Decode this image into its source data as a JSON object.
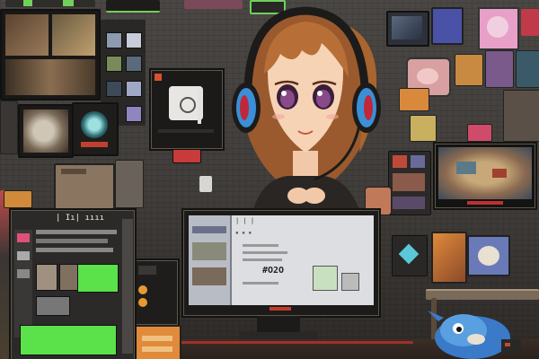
{
  "scene": {
    "description_free": true,
    "wall_color": "#45423f",
    "accent_colors": {
      "hair": "#b5703a",
      "headphone_blue": "#3a8fd8",
      "headphone_red": "#c0283a",
      "green_display": "#5be24a",
      "monitor_frame": "#1c1b1a"
    }
  },
  "center_monitor": {
    "screen_text_1": "| | |",
    "screen_text_2": "▪ ▪ ▪",
    "code_text": "#O2O"
  },
  "left_device": {
    "header_text": "| Iı| ıııı",
    "green_panel_color": "#5be24a"
  },
  "icons": [
    "person-silhouette-icon",
    "robot-mascot-icon",
    "controller-icon"
  ]
}
